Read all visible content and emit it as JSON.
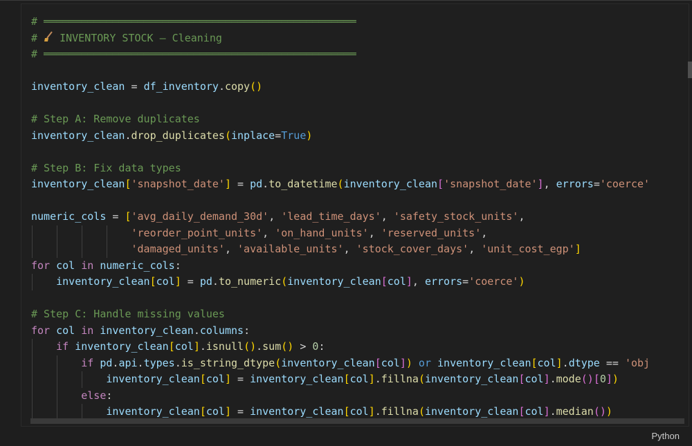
{
  "cell": {
    "language": "Python",
    "lines": [
      [
        {
          "t": "# ══════════════════════════════════════════════════",
          "c": "cmt"
        }
      ],
      [
        {
          "t": "# ",
          "c": "cmt"
        },
        {
          "icon": "broom-icon"
        },
        {
          "t": " INVENTORY STOCK — Cleaning",
          "c": "cmt"
        }
      ],
      [
        {
          "t": "# ══════════════════════════════════════════════════",
          "c": "cmt"
        }
      ],
      [],
      [
        {
          "t": "inventory_clean",
          "c": "var"
        },
        {
          "t": " = ",
          "c": "op"
        },
        {
          "t": "df_inventory",
          "c": "var"
        },
        {
          "t": ".",
          "c": "op"
        },
        {
          "t": "copy",
          "c": "fn"
        },
        {
          "t": "()",
          "c": "br1"
        }
      ],
      [],
      [
        {
          "t": "# Step A: Remove duplicates",
          "c": "cmt"
        }
      ],
      [
        {
          "t": "inventory_clean",
          "c": "var"
        },
        {
          "t": ".",
          "c": "op"
        },
        {
          "t": "drop_duplicates",
          "c": "fn"
        },
        {
          "t": "(",
          "c": "br1"
        },
        {
          "t": "inplace",
          "c": "var"
        },
        {
          "t": "=",
          "c": "op"
        },
        {
          "t": "True",
          "c": "bool"
        },
        {
          "t": ")",
          "c": "br1"
        }
      ],
      [],
      [
        {
          "t": "# Step B: Fix data types",
          "c": "cmt"
        }
      ],
      [
        {
          "t": "inventory_clean",
          "c": "var"
        },
        {
          "t": "[",
          "c": "br1"
        },
        {
          "t": "'snapshot_date'",
          "c": "str"
        },
        {
          "t": "]",
          "c": "br1"
        },
        {
          "t": " = ",
          "c": "op"
        },
        {
          "t": "pd",
          "c": "var"
        },
        {
          "t": ".",
          "c": "op"
        },
        {
          "t": "to_datetime",
          "c": "fn"
        },
        {
          "t": "(",
          "c": "br1"
        },
        {
          "t": "inventory_clean",
          "c": "var"
        },
        {
          "t": "[",
          "c": "br2"
        },
        {
          "t": "'snapshot_date'",
          "c": "str"
        },
        {
          "t": "]",
          "c": "br2"
        },
        {
          "t": ", ",
          "c": "op"
        },
        {
          "t": "errors",
          "c": "var"
        },
        {
          "t": "=",
          "c": "op"
        },
        {
          "t": "'coerce'",
          "c": "str"
        }
      ],
      [],
      [
        {
          "t": "numeric_cols",
          "c": "var"
        },
        {
          "t": " = ",
          "c": "op"
        },
        {
          "t": "[",
          "c": "br1"
        },
        {
          "t": "'avg_daily_demand_30d'",
          "c": "str"
        },
        {
          "t": ", ",
          "c": "op"
        },
        {
          "t": "'lead_time_days'",
          "c": "str"
        },
        {
          "t": ", ",
          "c": "op"
        },
        {
          "t": "'safety_stock_units'",
          "c": "str"
        },
        {
          "t": ",",
          "c": "op"
        }
      ],
      [
        {
          "t": "                ",
          "c": "op",
          "guides": 4
        },
        {
          "t": "'reorder_point_units'",
          "c": "str"
        },
        {
          "t": ", ",
          "c": "op"
        },
        {
          "t": "'on_hand_units'",
          "c": "str"
        },
        {
          "t": ", ",
          "c": "op"
        },
        {
          "t": "'reserved_units'",
          "c": "str"
        },
        {
          "t": ",",
          "c": "op"
        }
      ],
      [
        {
          "t": "                ",
          "c": "op",
          "guides": 4
        },
        {
          "t": "'damaged_units'",
          "c": "str"
        },
        {
          "t": ", ",
          "c": "op"
        },
        {
          "t": "'available_units'",
          "c": "str"
        },
        {
          "t": ", ",
          "c": "op"
        },
        {
          "t": "'stock_cover_days'",
          "c": "str"
        },
        {
          "t": ", ",
          "c": "op"
        },
        {
          "t": "'unit_cost_egp'",
          "c": "str"
        },
        {
          "t": "]",
          "c": "br1"
        }
      ],
      [
        {
          "t": "for",
          "c": "kw"
        },
        {
          "t": " col ",
          "c": "var"
        },
        {
          "t": "in",
          "c": "kw"
        },
        {
          "t": " numeric_cols",
          "c": "var"
        },
        {
          "t": ":",
          "c": "op"
        }
      ],
      [
        {
          "t": "    ",
          "c": "op",
          "guides": 1
        },
        {
          "t": "inventory_clean",
          "c": "var"
        },
        {
          "t": "[",
          "c": "br1"
        },
        {
          "t": "col",
          "c": "var"
        },
        {
          "t": "]",
          "c": "br1"
        },
        {
          "t": " = ",
          "c": "op"
        },
        {
          "t": "pd",
          "c": "var"
        },
        {
          "t": ".",
          "c": "op"
        },
        {
          "t": "to_numeric",
          "c": "fn"
        },
        {
          "t": "(",
          "c": "br1"
        },
        {
          "t": "inventory_clean",
          "c": "var"
        },
        {
          "t": "[",
          "c": "br2"
        },
        {
          "t": "col",
          "c": "var"
        },
        {
          "t": "]",
          "c": "br2"
        },
        {
          "t": ", ",
          "c": "op"
        },
        {
          "t": "errors",
          "c": "var"
        },
        {
          "t": "=",
          "c": "op"
        },
        {
          "t": "'coerce'",
          "c": "str"
        },
        {
          "t": ")",
          "c": "br1"
        }
      ],
      [],
      [
        {
          "t": "# Step C: Handle missing values",
          "c": "cmt"
        }
      ],
      [
        {
          "t": "for",
          "c": "kw"
        },
        {
          "t": " col ",
          "c": "var"
        },
        {
          "t": "in",
          "c": "kw"
        },
        {
          "t": " inventory_clean",
          "c": "var"
        },
        {
          "t": ".",
          "c": "op"
        },
        {
          "t": "columns",
          "c": "var"
        },
        {
          "t": ":",
          "c": "op"
        }
      ],
      [
        {
          "t": "    ",
          "c": "op",
          "guides": 1
        },
        {
          "t": "if",
          "c": "kw"
        },
        {
          "t": " inventory_clean",
          "c": "var"
        },
        {
          "t": "[",
          "c": "br1"
        },
        {
          "t": "col",
          "c": "var"
        },
        {
          "t": "]",
          "c": "br1"
        },
        {
          "t": ".",
          "c": "op"
        },
        {
          "t": "isnull",
          "c": "fn"
        },
        {
          "t": "()",
          "c": "br1"
        },
        {
          "t": ".",
          "c": "op"
        },
        {
          "t": "sum",
          "c": "fn"
        },
        {
          "t": "()",
          "c": "br1"
        },
        {
          "t": " > ",
          "c": "op"
        },
        {
          "t": "0",
          "c": "num"
        },
        {
          "t": ":",
          "c": "op"
        }
      ],
      [
        {
          "t": "        ",
          "c": "op",
          "guides": 2
        },
        {
          "t": "if",
          "c": "kw"
        },
        {
          "t": " pd",
          "c": "var"
        },
        {
          "t": ".",
          "c": "op"
        },
        {
          "t": "api",
          "c": "var"
        },
        {
          "t": ".",
          "c": "op"
        },
        {
          "t": "types",
          "c": "var"
        },
        {
          "t": ".",
          "c": "op"
        },
        {
          "t": "is_string_dtype",
          "c": "fn"
        },
        {
          "t": "(",
          "c": "br1"
        },
        {
          "t": "inventory_clean",
          "c": "var"
        },
        {
          "t": "[",
          "c": "br2"
        },
        {
          "t": "col",
          "c": "var"
        },
        {
          "t": "]",
          "c": "br2"
        },
        {
          "t": ")",
          "c": "br1"
        },
        {
          "t": " or",
          "c": "bool"
        },
        {
          "t": " inventory_clean",
          "c": "var"
        },
        {
          "t": "[",
          "c": "br1"
        },
        {
          "t": "col",
          "c": "var"
        },
        {
          "t": "]",
          "c": "br1"
        },
        {
          "t": ".",
          "c": "op"
        },
        {
          "t": "dtype",
          "c": "var"
        },
        {
          "t": " == ",
          "c": "op"
        },
        {
          "t": "'obj",
          "c": "str"
        }
      ],
      [
        {
          "t": "            ",
          "c": "op",
          "guides": 3
        },
        {
          "t": "inventory_clean",
          "c": "var"
        },
        {
          "t": "[",
          "c": "br1"
        },
        {
          "t": "col",
          "c": "var"
        },
        {
          "t": "]",
          "c": "br1"
        },
        {
          "t": " = ",
          "c": "op"
        },
        {
          "t": "inventory_clean",
          "c": "var"
        },
        {
          "t": "[",
          "c": "br1"
        },
        {
          "t": "col",
          "c": "var"
        },
        {
          "t": "]",
          "c": "br1"
        },
        {
          "t": ".",
          "c": "op"
        },
        {
          "t": "fillna",
          "c": "fn"
        },
        {
          "t": "(",
          "c": "br1"
        },
        {
          "t": "inventory_clean",
          "c": "var"
        },
        {
          "t": "[",
          "c": "br2"
        },
        {
          "t": "col",
          "c": "var"
        },
        {
          "t": "]",
          "c": "br2"
        },
        {
          "t": ".",
          "c": "op"
        },
        {
          "t": "mode",
          "c": "fn"
        },
        {
          "t": "()",
          "c": "br2"
        },
        {
          "t": "[",
          "c": "br2"
        },
        {
          "t": "0",
          "c": "num"
        },
        {
          "t": "]",
          "c": "br2"
        },
        {
          "t": ")",
          "c": "br1"
        }
      ],
      [
        {
          "t": "        ",
          "c": "op",
          "guides": 2
        },
        {
          "t": "else",
          "c": "kw"
        },
        {
          "t": ":",
          "c": "op"
        }
      ],
      [
        {
          "t": "            ",
          "c": "op",
          "guides": 3
        },
        {
          "t": "inventory_clean",
          "c": "var"
        },
        {
          "t": "[",
          "c": "br1"
        },
        {
          "t": "col",
          "c": "var"
        },
        {
          "t": "]",
          "c": "br1"
        },
        {
          "t": " = ",
          "c": "op"
        },
        {
          "t": "inventory_clean",
          "c": "var"
        },
        {
          "t": "[",
          "c": "br1"
        },
        {
          "t": "col",
          "c": "var"
        },
        {
          "t": "]",
          "c": "br1"
        },
        {
          "t": ".",
          "c": "op"
        },
        {
          "t": "fillna",
          "c": "fn"
        },
        {
          "t": "(",
          "c": "br1"
        },
        {
          "t": "inventory_clean",
          "c": "var"
        },
        {
          "t": "[",
          "c": "br2"
        },
        {
          "t": "col",
          "c": "var"
        },
        {
          "t": "]",
          "c": "br2"
        },
        {
          "t": ".",
          "c": "op"
        },
        {
          "t": "median",
          "c": "fn"
        },
        {
          "t": "()",
          "c": "br2"
        },
        {
          "t": ")",
          "c": "br1"
        }
      ]
    ]
  }
}
